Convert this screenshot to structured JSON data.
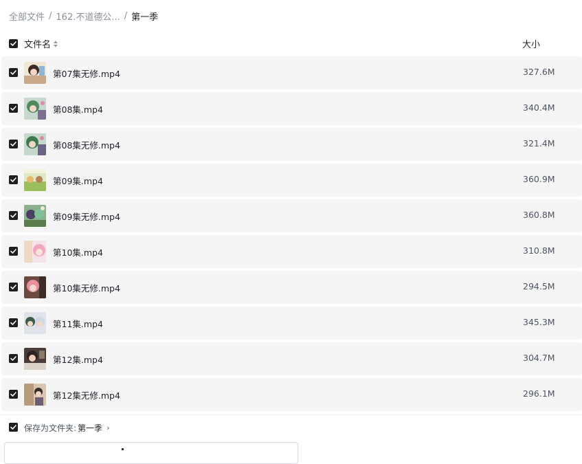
{
  "breadcrumb": {
    "root": "全部文件",
    "parent": "162.不道德公...",
    "current": "第一季",
    "separator": "/"
  },
  "header": {
    "name_label": "文件名",
    "size_label": "大小"
  },
  "files": [
    {
      "name": "第07集无修.mp4",
      "size": "327.6M"
    },
    {
      "name": "第08集.mp4",
      "size": "340.4M"
    },
    {
      "name": "第08集无修.mp4",
      "size": "321.4M"
    },
    {
      "name": "第09集.mp4",
      "size": "360.9M"
    },
    {
      "name": "第09集无修.mp4",
      "size": "360.8M"
    },
    {
      "name": "第10集.mp4",
      "size": "310.8M"
    },
    {
      "name": "第10集无修.mp4",
      "size": "294.5M"
    },
    {
      "name": "第11集.mp4",
      "size": "345.3M"
    },
    {
      "name": "第12集.mp4",
      "size": "304.7M"
    },
    {
      "name": "第12集无修.mp4",
      "size": "296.1M"
    }
  ],
  "save": {
    "label": "保存为文件夹:",
    "folder": "第一季",
    "chevron": "›"
  },
  "colors": {
    "checkbox": "#1f1f1f",
    "row_bg": "#f5f5f6",
    "muted_text": "#8a8f99"
  }
}
